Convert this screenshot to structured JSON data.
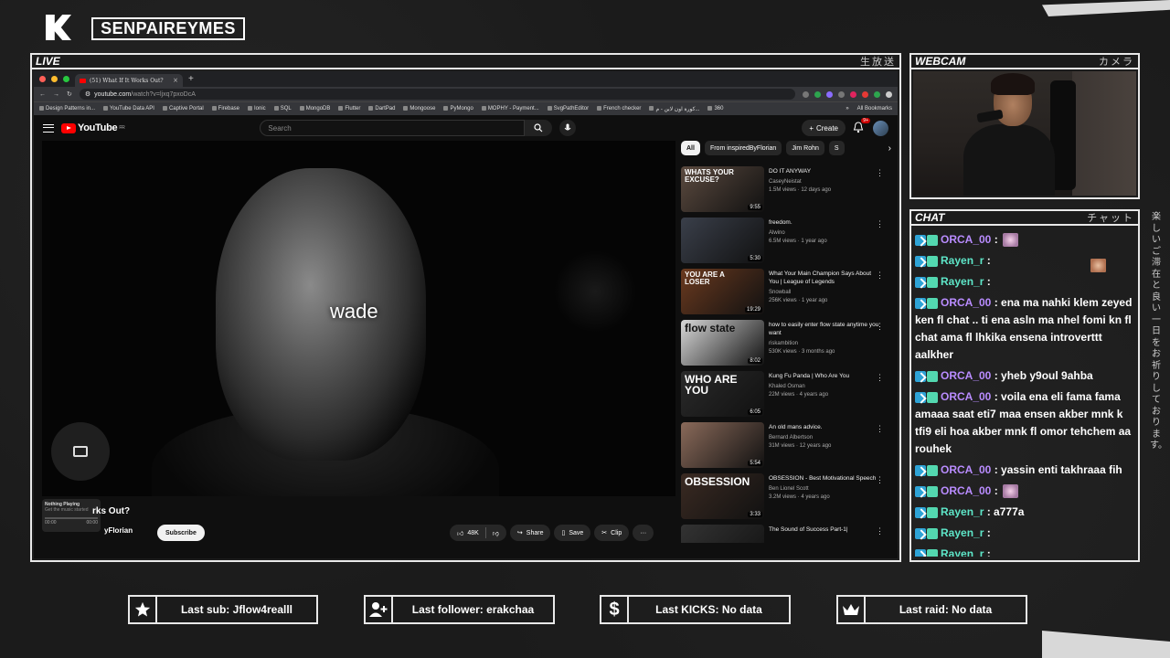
{
  "channel_name": "SENPAIREYMES",
  "live_panel": {
    "title": "LIVE",
    "jp": "生放送"
  },
  "webcam_panel": {
    "title": "WEBCAM",
    "jp": "カメラ"
  },
  "chat_panel": {
    "title": "CHAT",
    "jp": "チャット"
  },
  "vertical_jp": "楽しいご滞在と良い一日をお祈りしております。",
  "browser": {
    "tab_title": "(51) What If It Works Out?",
    "tab_close": "×",
    "new_tab": "+",
    "url_host": "youtube.com",
    "url_path": "/watch?v=ljxq7pxoDcA",
    "bookmarks": [
      "Design Patterns in...",
      "YouTube Data API",
      "Captive Portal",
      "Firebase",
      "Ionic",
      "SQL",
      "MongoDB",
      "Flutter",
      "DartPad",
      "Mongoose",
      "PyMongo",
      "MOPHY - Payment...",
      "SvgPathEditor",
      "French checker",
      "كورة اون لاين - م...",
      "360"
    ],
    "bookmarks_more": "»",
    "all_bookmarks": "All Bookmarks"
  },
  "youtube": {
    "logo_text": "YouTube",
    "logo_sup": "FR",
    "search_placeholder": "Search",
    "create_label": "Create",
    "notif_count": "9+",
    "caption": "wade",
    "video_title": "What If It Works Out?",
    "video_title_visible": "rks Out?",
    "channel": "inspiredByFlorian",
    "channel_visible": "yFlorian",
    "subscribe_label": "Subscribe",
    "likes": "48K",
    "share_label": "Share",
    "save_label": "Save",
    "clip_label": "Clip",
    "more_label": "···",
    "now_playing": {
      "title": "Nothing Playing",
      "sub": "Get the music started",
      "time_start": "00:00",
      "time_end": "00:00"
    },
    "chips": [
      "All",
      "From inspiredByFlorian",
      "Jim Rohn",
      "S"
    ],
    "chip_next": "›",
    "recommendations": [
      {
        "title": "DO IT ANYWAY",
        "channel": "CaseyNeistat",
        "meta": "1.5M views · 12 days ago",
        "duration": "9:55",
        "overlay": "WHATS YOUR EXCUSE?",
        "color": "#5b4a3f"
      },
      {
        "title": "freedom.",
        "channel": "Alwino",
        "meta": "6.5M views · 1 year ago",
        "duration": "5:30",
        "overlay": "",
        "color": "#3a3f4a"
      },
      {
        "title": "What Your Main Champion Says About You | League of Legends",
        "channel": "Snowball",
        "meta": "256K views · 1 year ago",
        "duration": "19:29",
        "overlay": "YOU ARE A LOSER",
        "color": "#6b3a1f"
      },
      {
        "title": "how to easily enter flow state anytime you want",
        "channel": "riskambition",
        "meta": "530K views · 3 months ago",
        "duration": "8:02",
        "overlay": "flow state",
        "color": "#d8d8d8"
      },
      {
        "title": "Kung Fu Panda | Who Are You",
        "channel": "Khaled Osman",
        "meta": "22M views · 4 years ago",
        "duration": "6:05",
        "overlay": "WHO ARE YOU",
        "color": "#2a2a2a"
      },
      {
        "title": "An old mans advice.",
        "channel": "Bernard Albertson",
        "meta": "31M views · 12 years ago",
        "duration": "5:54",
        "overlay": "",
        "color": "#8a6a5a"
      },
      {
        "title": "OBSESSION - Best Motivational Speech",
        "channel": "Ben Lionel Scott",
        "meta": "3.2M views · 4 years ago",
        "duration": "3:33",
        "overlay": "OBSESSION",
        "color": "#3a2a22"
      },
      {
        "title": "The Sound of Success Part-1|",
        "channel": "",
        "meta": "",
        "duration": "",
        "overlay": "",
        "color": "#333"
      }
    ]
  },
  "chat": [
    {
      "user": "ORCA_00",
      "color": "#b98cff",
      "text": "",
      "emote": "pink"
    },
    {
      "user": "Rayen_r",
      "color": "#5ee6c8",
      "text": "",
      "emote": "face"
    },
    {
      "user": "Rayen_r",
      "color": "#5ee6c8",
      "text": "",
      "emote": "face"
    },
    {
      "user": "ORCA_00",
      "color": "#b98cff",
      "text": "ena ma nahki klem zeyed ken fl chat .. ti ena asln ma nhel fomi kn fl chat ama fl lhkika ensena introverttt aalkher",
      "emote": ""
    },
    {
      "user": "ORCA_00",
      "color": "#b98cff",
      "text": "yheb y9oul 9ahba",
      "emote": ""
    },
    {
      "user": "ORCA_00",
      "color": "#b98cff",
      "text": "voila ena eli fama fama amaaa saat eti7 maa ensen akber mnk k tfi9 eli hoa akber mnk fl omor tehchem aa rouhek",
      "emote": ""
    },
    {
      "user": "ORCA_00",
      "color": "#b98cff",
      "text": "yassin enti takhraaa fih",
      "emote": ""
    },
    {
      "user": "ORCA_00",
      "color": "#b98cff",
      "text": "",
      "emote": "pink"
    },
    {
      "user": "Rayen_r",
      "color": "#5ee6c8",
      "text": "a777a",
      "emote": ""
    },
    {
      "user": "Rayen_r",
      "color": "#5ee6c8",
      "text": "",
      "emote": "face"
    },
    {
      "user": "Rayen_r",
      "color": "#5ee6c8",
      "text": "",
      "emote": "face"
    }
  ],
  "stats": {
    "sub": "Last sub: Jflow4realll",
    "follower": "Last follower: erakchaa",
    "kicks": "Last KICKS: No data",
    "raid": "Last raid: No data"
  }
}
